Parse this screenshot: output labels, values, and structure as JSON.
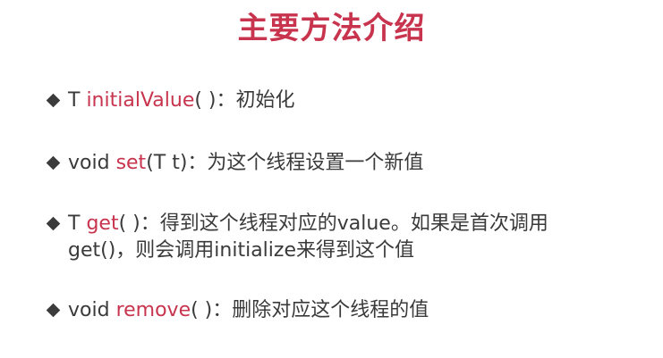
{
  "title": "主要方法介绍",
  "colors": {
    "accent": "#c8344e",
    "text": "#3a3a3a",
    "bullet": "#3b3b3b"
  },
  "bullet_icon": "diamond-bullet",
  "items": [
    {
      "prefix": "T ",
      "method": "initialValue",
      "suffix": "( )：初始化"
    },
    {
      "prefix": "void ",
      "method": "set",
      "suffix": "(T t)：为这个线程设置一个新值"
    },
    {
      "prefix": "T ",
      "method": "get",
      "suffix": "( )：得到这个线程对应的value。如果是首次调用",
      "line2": "get()，则会调用initialize来得到这个值"
    },
    {
      "prefix": "void ",
      "method": "remove",
      "suffix": "( )：删除对应这个线程的值"
    }
  ]
}
